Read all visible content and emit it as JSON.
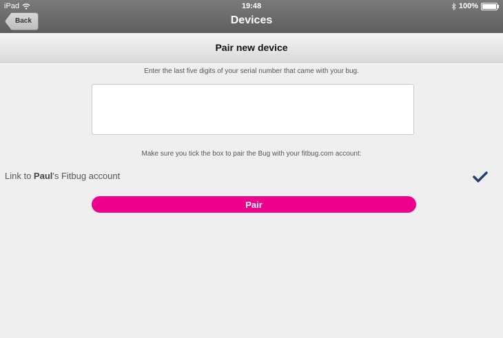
{
  "status_bar": {
    "device": "iPad",
    "time": "19:48",
    "battery_percent": "100%",
    "battery_level": 1.0,
    "icons": [
      "wifi-icon",
      "bluetooth-icon",
      "battery-icon"
    ]
  },
  "nav": {
    "back_label": "Back",
    "title": "Devices"
  },
  "section": {
    "title": "Pair new device"
  },
  "form": {
    "instruction": "Enter the last five digits of your serial number that came with your bug.",
    "serial_value": "",
    "tick_instruction": "Make sure you tick the box to pair the Bug with your fitbug.com account:",
    "link_prefix": "Link to ",
    "link_user": "Paul",
    "link_suffix": "'s Fitbug account",
    "link_checked": true,
    "pair_label": "Pair"
  },
  "colors": {
    "accent": "#ec008c",
    "check": "#1f3f6e",
    "nav_bar": "#6b6b6b",
    "background": "#efefef"
  }
}
